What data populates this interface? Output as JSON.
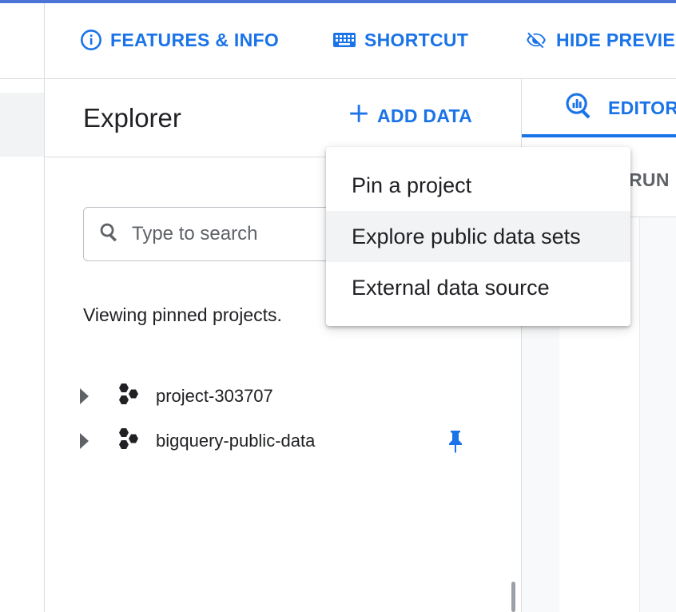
{
  "toolbar": {
    "features_label": "FEATURES & INFO",
    "shortcut_label": "SHORTCUT",
    "hide_preview_label": "HIDE PREVIE"
  },
  "explorer": {
    "title": "Explorer",
    "add_data_label": "ADD DATA",
    "search_placeholder": "Type to search",
    "viewing_text": "Viewing pinned projects.",
    "projects": [
      {
        "name": "project-303707",
        "pinned": false
      },
      {
        "name": "bigquery-public-data",
        "pinned": true
      }
    ]
  },
  "add_data_menu": {
    "items": [
      {
        "label": "Pin a project"
      },
      {
        "label": "Explore public data sets"
      },
      {
        "label": "External data source"
      }
    ],
    "hovered_index": 1
  },
  "editor": {
    "tab_label": "EDITOR",
    "run_label": "RUN"
  },
  "colors": {
    "accent": "#1a73e8",
    "text": "#202124",
    "divider": "#dadce0"
  }
}
